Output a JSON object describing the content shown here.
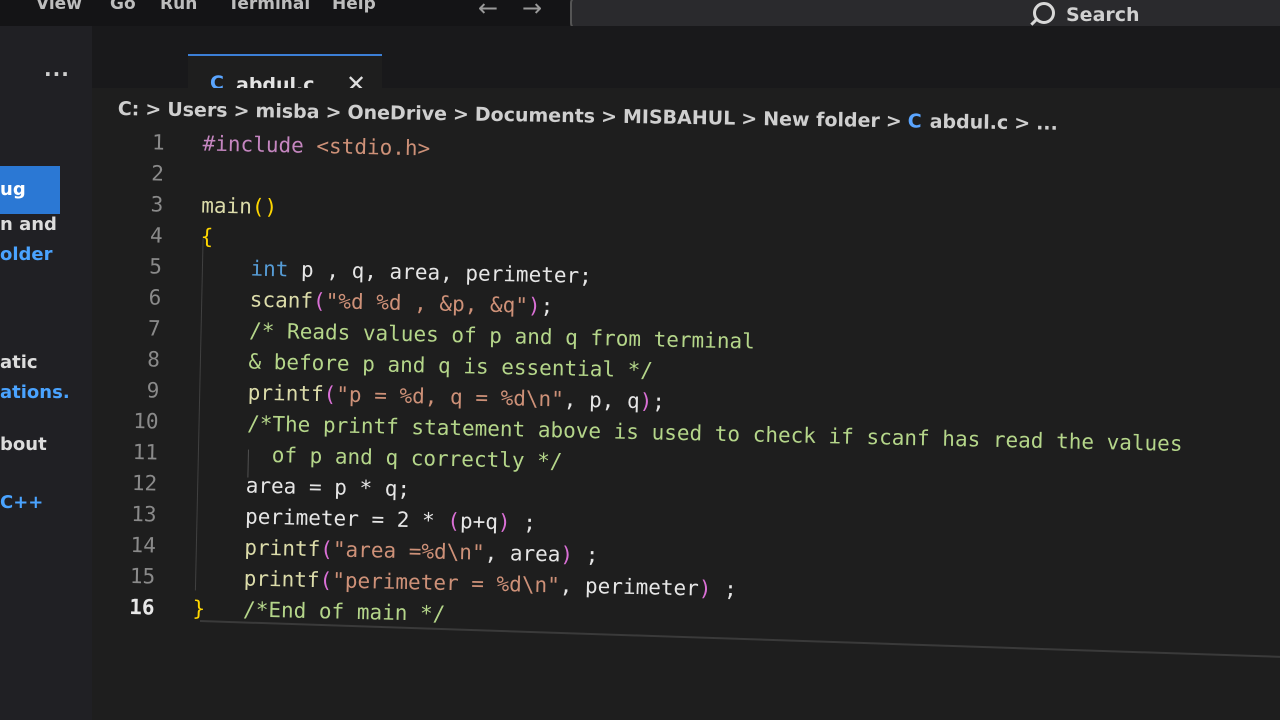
{
  "menu": {
    "items": [
      "View",
      "Go",
      "Run",
      "Terminal",
      "Help"
    ],
    "search_label": "Search"
  },
  "sidebar": {
    "dots": "···",
    "button_label": "ug",
    "texts": [
      "n and",
      "older",
      "atic",
      "ations.",
      "bout",
      "C++"
    ]
  },
  "tab": {
    "lang_icon": "C",
    "filename": "abdul.c",
    "close": "✕"
  },
  "breadcrumb": {
    "parts": [
      "C:",
      "Users",
      "misba",
      "OneDrive",
      "Documents",
      "MISBAHUL",
      "New folder",
      "abdul.c",
      "..."
    ],
    "separator": ">",
    "file_icon": "C"
  },
  "editor": {
    "active_line": 16,
    "line_numbers": [
      "1",
      "2",
      "3",
      "4",
      "5",
      "6",
      "7",
      "8",
      "9",
      "10",
      "11",
      "12",
      "13",
      "14",
      "15",
      "16"
    ],
    "lines": [
      [
        {
          "t": "#include ",
          "c": "kw-pre"
        },
        {
          "t": "<stdio.h>",
          "c": "str"
        }
      ],
      [],
      [
        {
          "t": "main",
          "c": "fn"
        },
        {
          "t": "()",
          "c": "brace"
        }
      ],
      [
        {
          "t": "{",
          "c": "brace"
        }
      ],
      [
        {
          "t": "    int ",
          "c": "type"
        },
        {
          "t": "p , q, area, perimeter;",
          "c": "var"
        }
      ],
      [
        {
          "t": "    scanf",
          "c": "fn"
        },
        {
          "t": "(",
          "c": "paren"
        },
        {
          "t": "\"%d %d , &p, &q\"",
          "c": "str"
        },
        {
          "t": ")",
          "c": "paren"
        },
        {
          "t": ";",
          "c": "var"
        }
      ],
      [
        {
          "t": "    /* Reads values of p and q from terminal",
          "c": "cmt"
        }
      ],
      [
        {
          "t": "    & before p and q is essential */",
          "c": "cmt"
        }
      ],
      [
        {
          "t": "    printf",
          "c": "fn"
        },
        {
          "t": "(",
          "c": "paren"
        },
        {
          "t": "\"p = %d, q = %d\\n\"",
          "c": "str"
        },
        {
          "t": ", p, q",
          "c": "var"
        },
        {
          "t": ")",
          "c": "paren"
        },
        {
          "t": ";",
          "c": "var"
        }
      ],
      [
        {
          "t": "    /*The printf statement above is used to check if scanf has read the values",
          "c": "cmt"
        }
      ],
      [
        {
          "t": "      of p and q correctly */",
          "c": "cmt"
        }
      ],
      [
        {
          "t": "    area = p * q;",
          "c": "var"
        }
      ],
      [
        {
          "t": "    perimeter = 2 * ",
          "c": "var"
        },
        {
          "t": "(",
          "c": "paren"
        },
        {
          "t": "p+q",
          "c": "var"
        },
        {
          "t": ")",
          "c": "paren"
        },
        {
          "t": " ;",
          "c": "var"
        }
      ],
      [
        {
          "t": "    printf",
          "c": "fn"
        },
        {
          "t": "(",
          "c": "paren"
        },
        {
          "t": "\"area =%d\\n\"",
          "c": "str"
        },
        {
          "t": ", area",
          "c": "var"
        },
        {
          "t": ")",
          "c": "paren"
        },
        {
          "t": " ;",
          "c": "var"
        }
      ],
      [
        {
          "t": "    printf",
          "c": "fn"
        },
        {
          "t": "(",
          "c": "paren"
        },
        {
          "t": "\"perimeter = %d\\n\"",
          "c": "str"
        },
        {
          "t": ", perimeter",
          "c": "var"
        },
        {
          "t": ")",
          "c": "paren"
        },
        {
          "t": " ;",
          "c": "var"
        }
      ],
      [
        {
          "t": "}",
          "c": "brace"
        },
        {
          "t": "   /*End of main */",
          "c": "cmt"
        }
      ]
    ]
  },
  "colors": {
    "accent": "#2b78d4",
    "comment": "#b5d68a",
    "string": "#ce9178",
    "function": "#dcdcaa",
    "keyword": "#569cd6"
  }
}
